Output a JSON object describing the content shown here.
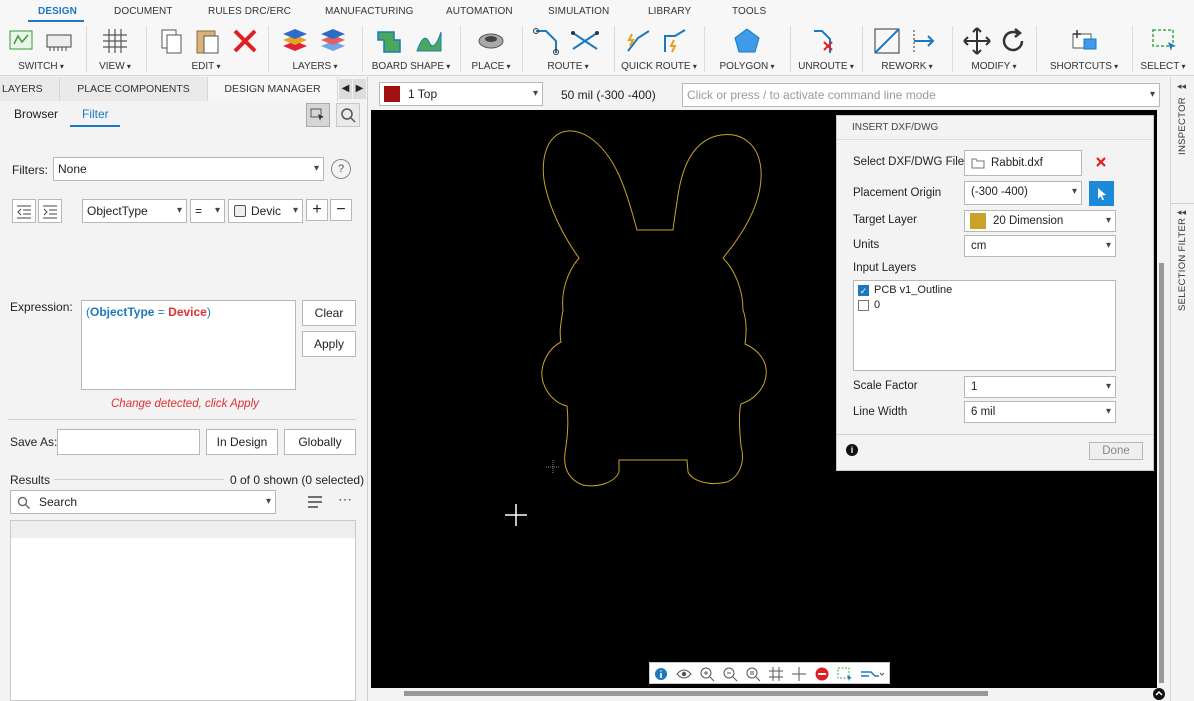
{
  "tabs": [
    "DESIGN",
    "DOCUMENT",
    "RULES DRC/ERC",
    "MANUFACTURING",
    "AUTOMATION",
    "SIMULATION",
    "LIBRARY",
    "TOOLS"
  ],
  "ribbon": {
    "switch": "SWITCH",
    "view": "VIEW",
    "edit": "EDIT",
    "layers": "LAYERS",
    "board_shape": "BOARD SHAPE",
    "place": "PLACE",
    "route": "ROUTE",
    "quick_route": "QUICK ROUTE",
    "polygon": "POLYGON",
    "unroute": "UNROUTE",
    "rework": "REWORK",
    "modify": "MODIFY",
    "shortcuts": "SHORTCUTS",
    "select": "SELECT"
  },
  "panel_tabs": [
    "LAYERS",
    "PLACE COMPONENTS",
    "DESIGN MANAGER"
  ],
  "subtabs": {
    "browser": "Browser",
    "filter": "Filter"
  },
  "filters": {
    "label": "Filters:",
    "value": "None",
    "help": "?"
  },
  "condition": {
    "field": "ObjectType",
    "op": "=",
    "value": "Devic"
  },
  "expression": {
    "label": "Expression:",
    "open": "(",
    "key": "ObjectType",
    "eq": " = ",
    "val": "Device",
    "close": ")",
    "clear": "Clear",
    "apply": "Apply",
    "warning": "Change detected, click Apply"
  },
  "save": {
    "label": "Save As:",
    "value": "",
    "in_design": "In Design",
    "globally": "Globally"
  },
  "results": {
    "label": "Results",
    "count": "0 of 0 shown (0 selected)",
    "search": "Search"
  },
  "layerbar": {
    "layer": "1 Top",
    "grid": "50 mil (-300 -400)",
    "command_placeholder": "Click or press / to activate command line mode",
    "layer_color": "#a01010"
  },
  "dialog": {
    "title": "INSERT DXF/DWG",
    "file_label": "Select DXF/DWG File",
    "file": "Rabbit.dxf",
    "origin_label": "Placement Origin",
    "origin": "(-300 -400)",
    "target_label": "Target Layer",
    "target": "20 Dimension",
    "target_color": "#c9a227",
    "units_label": "Units",
    "units": "cm",
    "input_layers_label": "Input Layers",
    "input_layers": [
      {
        "name": "PCB v1_Outline",
        "checked": true
      },
      {
        "name": "0",
        "checked": false
      }
    ],
    "scale_label": "Scale Factor",
    "scale": "1",
    "width_label": "Line Width",
    "width": "6 mil",
    "done": "Done"
  },
  "side": {
    "inspector": "INSPECTOR",
    "selection_filter": "SELECTION FILTER"
  },
  "colors": {
    "accent": "#1c79c0",
    "outline": "#c9a227",
    "canvas": "#000000",
    "danger": "#e02020"
  }
}
